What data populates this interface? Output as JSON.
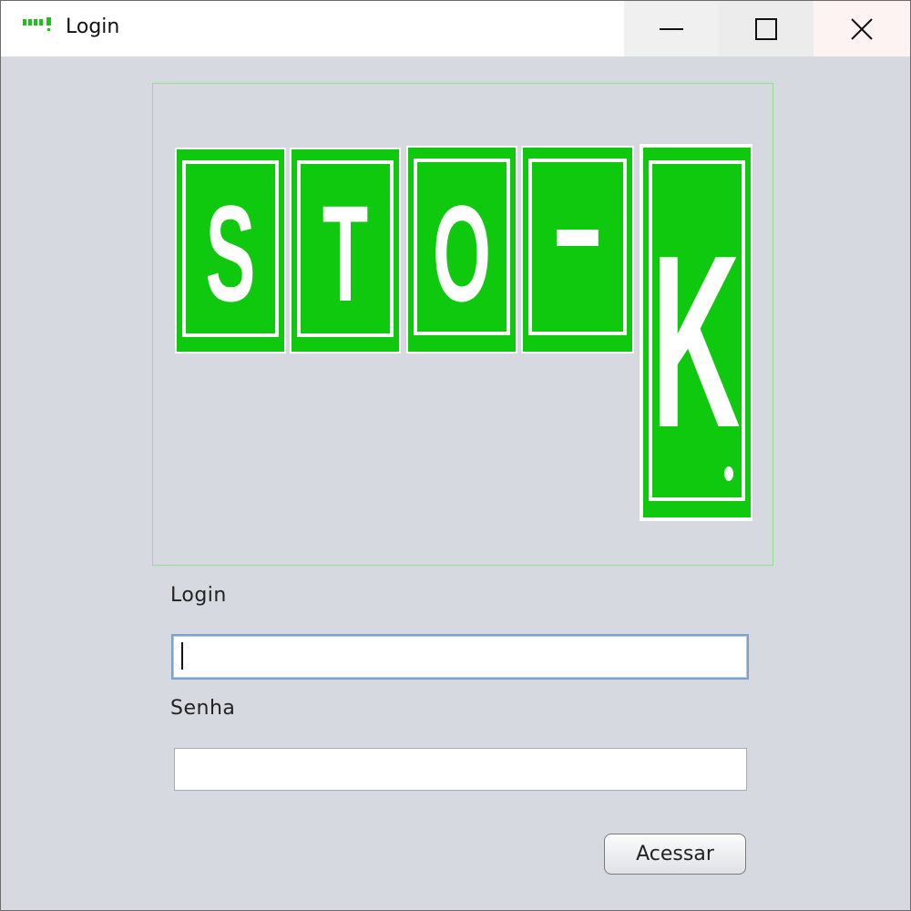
{
  "window": {
    "title": "Login",
    "app_icon": "stok-app-icon",
    "controls": {
      "minimize": "minimize-icon",
      "maximize": "maximize-icon",
      "close": "close-icon"
    }
  },
  "logo": {
    "letters": [
      "S",
      "T",
      "O",
      "-",
      "K"
    ],
    "accent_color": "#0ec90e"
  },
  "form": {
    "login_label": "Login",
    "login_value": "",
    "password_label": "Senha",
    "password_value": "",
    "submit_label": "Acessar"
  }
}
